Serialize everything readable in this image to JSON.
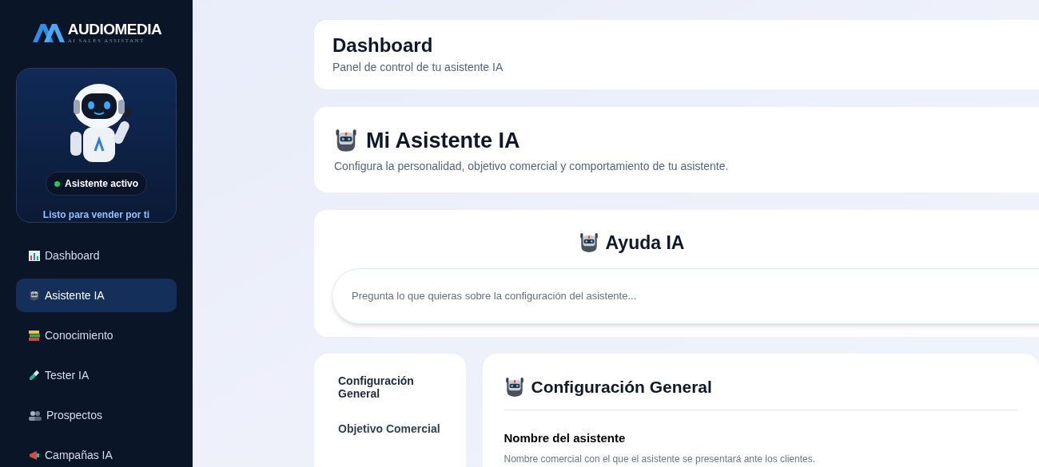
{
  "sidebar": {
    "logo": {
      "name": "AUDIOMEDIA",
      "tagline": "AI SALES ASSISTANT"
    },
    "assistant_card": {
      "status": "Asistente activo",
      "active": true,
      "caption": "Listo para vender por ti"
    },
    "items": [
      {
        "label": "Dashboard",
        "selected": false
      },
      {
        "label": "Asistente IA",
        "selected": true
      },
      {
        "label": "Conocimiento",
        "selected": false
      },
      {
        "label": "Tester IA",
        "selected": false
      },
      {
        "label": "Prospectos",
        "selected": false
      },
      {
        "label": "Campañas IA",
        "selected": false
      }
    ]
  },
  "header": {
    "title": "Dashboard",
    "subtitle": "Panel de control de tu asistente IA"
  },
  "assistant": {
    "title": "Mi Asistente IA",
    "subtitle": "Configura la personalidad, objetivo comercial y comportamiento de tu asistente."
  },
  "help": {
    "title": "Ayuda IA",
    "placeholder": "Pregunta lo que quieras sobre la configuración del asistente..."
  },
  "sections": [
    {
      "label": "Configuración General",
      "selected": true
    },
    {
      "label": "Objetivo Comercial",
      "selected": false
    }
  ],
  "config": {
    "title": "Configuración General",
    "field_label": "Nombre del asistente",
    "field_hint": "Nombre comercial con el que el asistente se presentará ante los clientes."
  }
}
